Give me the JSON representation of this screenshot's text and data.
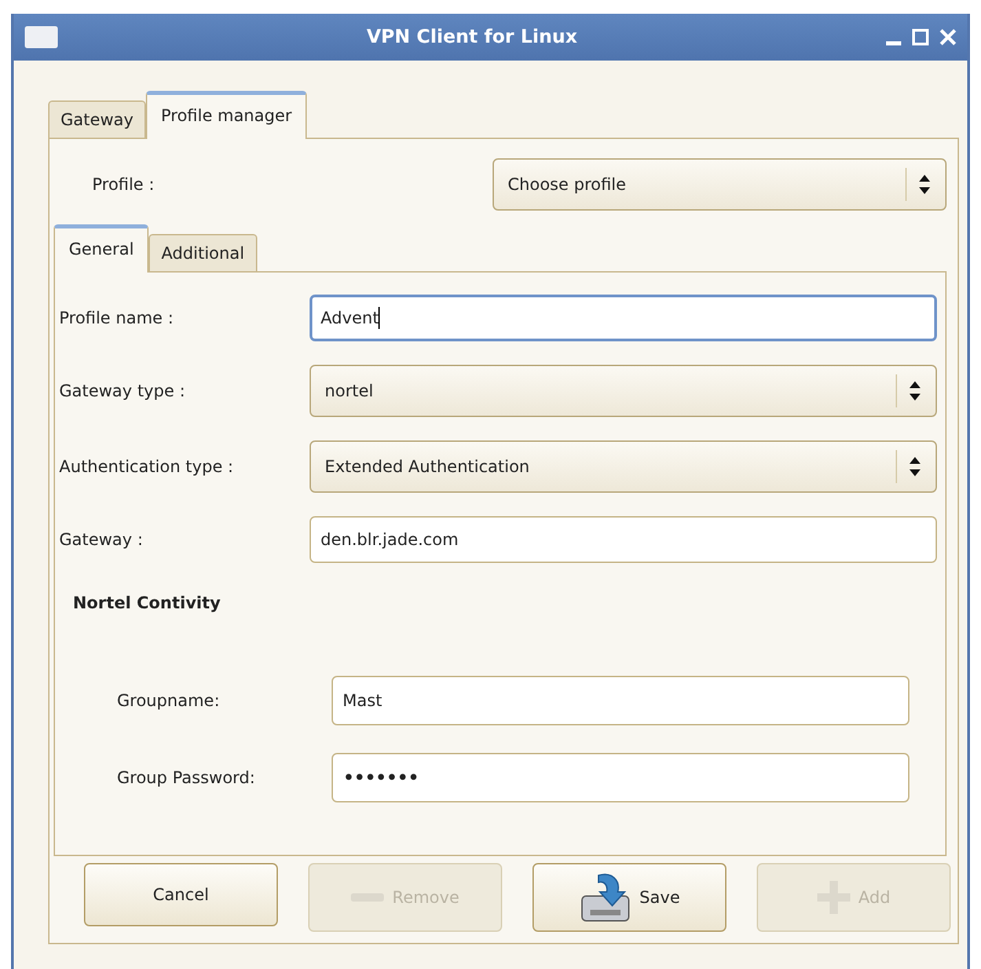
{
  "window": {
    "title": "VPN Client for Linux"
  },
  "tabs": [
    {
      "label": "Gateway",
      "selected": false
    },
    {
      "label": "Profile manager",
      "selected": true
    }
  ],
  "profile": {
    "label": "Profile :",
    "value": "Choose profile"
  },
  "subtabs": [
    {
      "label": "General",
      "selected": true
    },
    {
      "label": "Additional",
      "selected": false
    }
  ],
  "fields": [
    {
      "kind": "text",
      "label": "Profile name :",
      "value": "Advent",
      "focused": true
    },
    {
      "kind": "select",
      "label": "Gateway type :",
      "value": "nortel"
    },
    {
      "kind": "select",
      "label": "Authentication type :",
      "value": "Extended Authentication"
    },
    {
      "kind": "text",
      "label": "Gateway :",
      "value": "den.blr.jade.com",
      "focused": false
    }
  ],
  "section": {
    "title": "Nortel Contivity",
    "fields": [
      {
        "kind": "text",
        "label": "Groupname:",
        "value": "Mast"
      },
      {
        "kind": "password",
        "label": "Group Password:",
        "value": "•••••••"
      }
    ]
  },
  "buttons": [
    {
      "label": "Cancel",
      "kind": "plain",
      "disabled": false
    },
    {
      "label": "Remove",
      "kind": "remove",
      "disabled": true
    },
    {
      "label": "Save",
      "kind": "save",
      "disabled": false
    },
    {
      "label": "Add",
      "kind": "add",
      "disabled": true
    }
  ]
}
